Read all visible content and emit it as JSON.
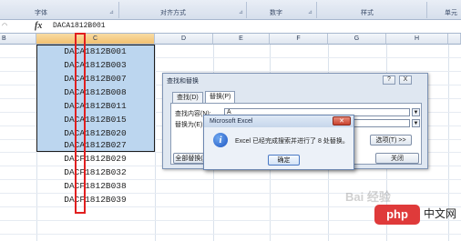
{
  "ribbon": {
    "groups": [
      "字体",
      "对齐方式",
      "数字",
      "样式",
      "单元"
    ]
  },
  "formula_bar": {
    "fx": "fx",
    "value": "DACA1812B001"
  },
  "columns": {
    "b": "B",
    "c": "C",
    "d": "D",
    "e": "E",
    "f": "F",
    "g": "G",
    "h": "H"
  },
  "cells": [
    "DACA1812B001",
    "DACA1812B003",
    "DACA1812B007",
    "DACA1812B008",
    "DACA1812B011",
    "DACA1812B015",
    "DACA1812B020",
    "DACA1812B027",
    "DACF1812B029",
    "DACF1812B032",
    "DACF1812B038",
    "DACF1812B039"
  ],
  "find_replace": {
    "title": "查找和替换",
    "help": "?",
    "close": "X",
    "tab_find": "查找(D)",
    "tab_replace": "替换(P)",
    "find_label": "查找内容(N):",
    "find_value": "A",
    "replace_label": "替换为(E):",
    "replace_value": "F",
    "options_button": "选项(T) >>",
    "replace_all_button": "全部替换(A)",
    "close_button": "关闭"
  },
  "message": {
    "title": "Microsoft Excel",
    "text": "Excel 已经完成搜索并进行了 8 处替换。",
    "ok": "确定"
  },
  "watermarks": {
    "baidu": "Bai 经验",
    "php": "php",
    "cn": "中文网"
  }
}
